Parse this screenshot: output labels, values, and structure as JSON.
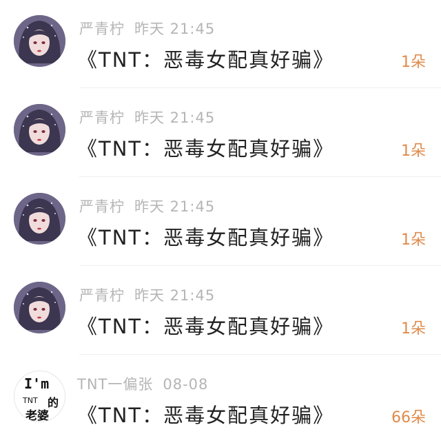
{
  "list": [
    {
      "user": "严青柠",
      "time": "昨天 21:45",
      "title": "《TNT：恶毒女配真好骗》",
      "count": "1朵",
      "avatar": "girl-avatar"
    },
    {
      "user": "严青柠",
      "time": "昨天 21:45",
      "title": "《TNT：恶毒女配真好骗》",
      "count": "1朵",
      "avatar": "girl-avatar"
    },
    {
      "user": "严青柠",
      "time": "昨天 21:45",
      "title": "《TNT：恶毒女配真好骗》",
      "count": "1朵",
      "avatar": "girl-avatar"
    },
    {
      "user": "严青柠",
      "time": "昨天 21:45",
      "title": "《TNT：恶毒女配真好骗》",
      "count": "1朵",
      "avatar": "girl-avatar"
    },
    {
      "user": "TNT一偏张",
      "time": "08-08",
      "title": "《TNT：恶毒女配真好骗》",
      "count": "66朵",
      "avatar": "text-avatar",
      "avatar_text": {
        "line1": "I'm",
        "line2": "TNT",
        "line3": "的",
        "line4": "老婆"
      }
    }
  ],
  "colors": {
    "meta": "#b5b5b5",
    "title": "#222222",
    "count": "#e08a4a",
    "divider": "#efefef"
  }
}
